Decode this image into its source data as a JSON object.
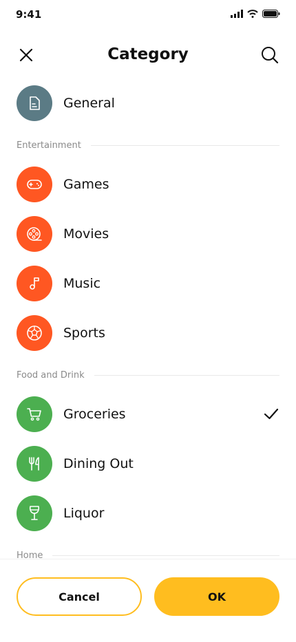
{
  "status": {
    "time": "9:41"
  },
  "header": {
    "title": "Category"
  },
  "colors": {
    "general": "#5b7b85",
    "entertainment": "#ff5722",
    "food": "#4caf50",
    "accent": "#ffbd1f"
  },
  "list": {
    "general": {
      "label": "General",
      "icon": "document-icon"
    },
    "sections": [
      {
        "label": "Entertainment",
        "items": [
          {
            "label": "Games",
            "icon": "gamepad-icon"
          },
          {
            "label": "Movies",
            "icon": "film-reel-icon"
          },
          {
            "label": "Music",
            "icon": "music-note-icon"
          },
          {
            "label": "Sports",
            "icon": "soccer-ball-icon"
          }
        ]
      },
      {
        "label": "Food and Drink",
        "items": [
          {
            "label": "Groceries",
            "icon": "shopping-cart-icon",
            "selected": true
          },
          {
            "label": "Dining Out",
            "icon": "fork-knife-icon"
          },
          {
            "label": "Liquor",
            "icon": "wine-glass-icon"
          }
        ]
      },
      {
        "label": "Home",
        "items": []
      }
    ]
  },
  "footer": {
    "cancel": "Cancel",
    "ok": "OK"
  }
}
